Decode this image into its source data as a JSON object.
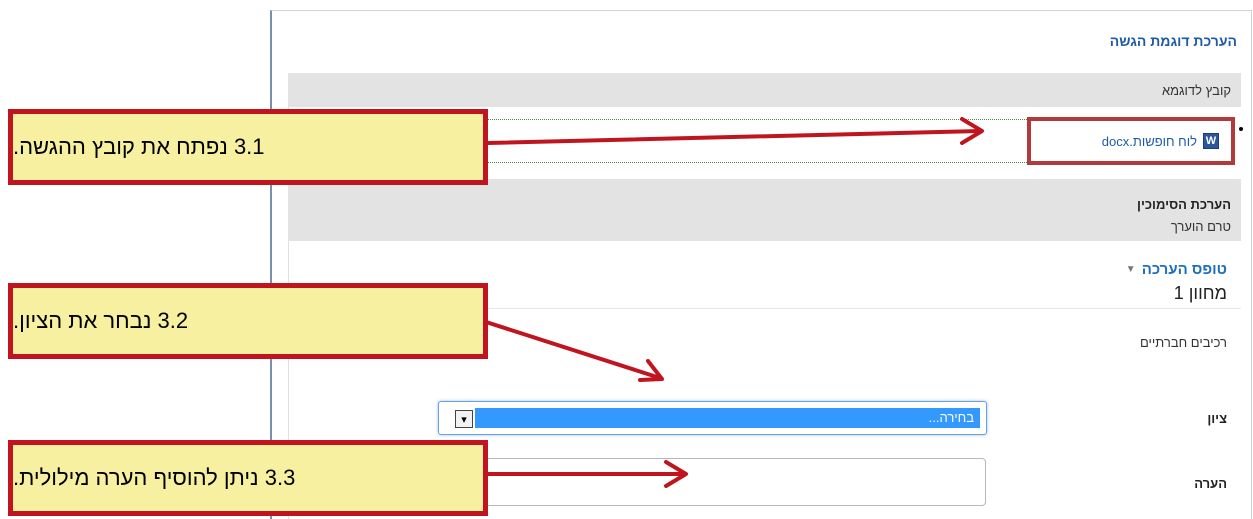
{
  "panel": {
    "title": "הערכת דוגמת הגשה",
    "example_section_label": "קובץ לדוגמא",
    "file": {
      "name": "לוח חופשות.docx",
      "icon": "word-document-icon",
      "icon_glyph": "W"
    },
    "grading_section_title": "הערכת הסימוכין",
    "grading_status": "טרם הוערך",
    "form_heading": "טופס הערכה",
    "rubric_level": "מחוון 1",
    "criterion_label": "רכיבים חברתיים",
    "grade_label": "ציון",
    "grade_select_value": "בחירה...",
    "comment_label": "הערה",
    "comment_value": ""
  },
  "callouts": {
    "step1": "3.1 נפתח את קובץ ההגשה.",
    "step2": "3.2 נבחר את הציון.",
    "step3": "3.3 ניתן להוסיף הערה מילולית."
  },
  "colors": {
    "callout_fill": "#f6f0a0",
    "callout_border": "#c0151f",
    "link": "#1f5aa6",
    "highlight_box": "#b23a3a"
  }
}
